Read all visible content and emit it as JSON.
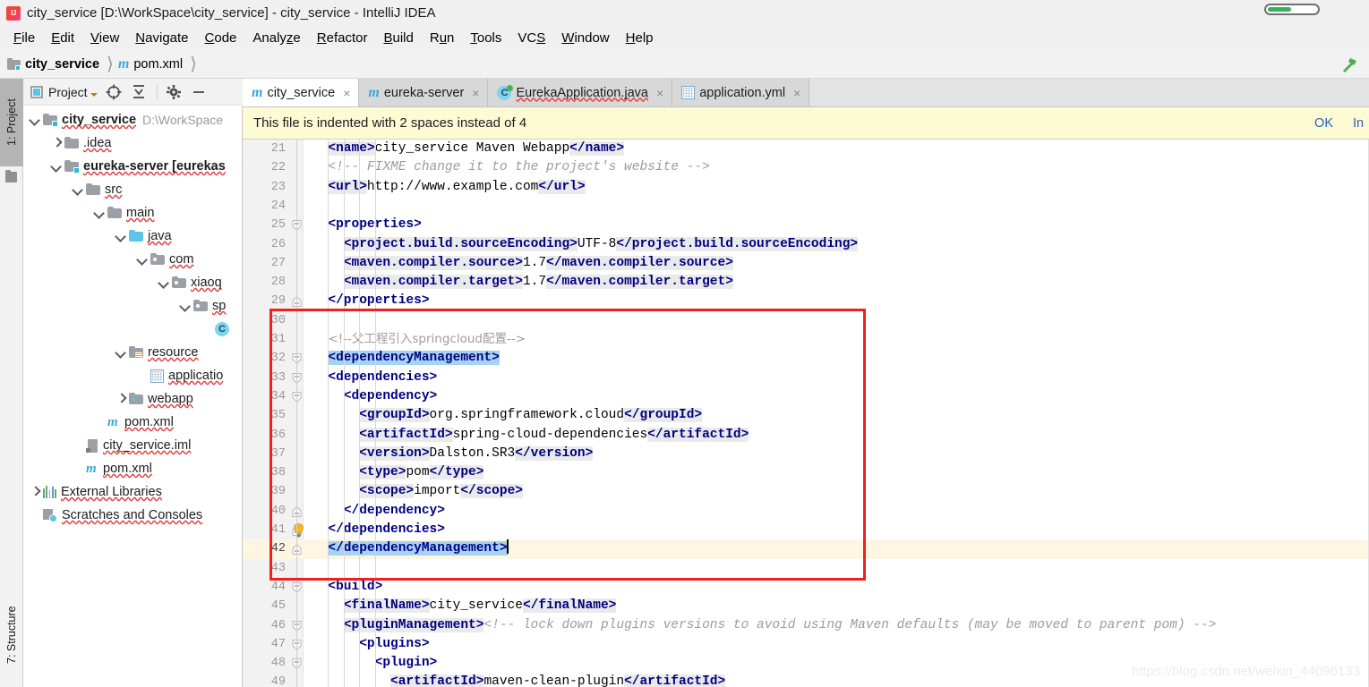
{
  "window": {
    "title": "city_service [D:\\WorkSpace\\city_service] - city_service - IntelliJ IDEA",
    "app_icon": "IJ"
  },
  "menubar": {
    "items": [
      {
        "label": "File",
        "mnemonic": "F"
      },
      {
        "label": "Edit",
        "mnemonic": "E"
      },
      {
        "label": "View",
        "mnemonic": "V"
      },
      {
        "label": "Navigate",
        "mnemonic": "N"
      },
      {
        "label": "Code",
        "mnemonic": "C"
      },
      {
        "label": "Analyze",
        "mnemonic": "z"
      },
      {
        "label": "Refactor",
        "mnemonic": "R"
      },
      {
        "label": "Build",
        "mnemonic": "B"
      },
      {
        "label": "Run",
        "mnemonic": "u"
      },
      {
        "label": "Tools",
        "mnemonic": "T"
      },
      {
        "label": "VCS",
        "mnemonic": "S"
      },
      {
        "label": "Window",
        "mnemonic": "W"
      },
      {
        "label": "Help",
        "mnemonic": "H"
      }
    ]
  },
  "navbar": {
    "crumbs": [
      {
        "label": "city_service",
        "icon": "module-icon"
      },
      {
        "label": "pom.xml",
        "icon": "maven-icon"
      }
    ],
    "build_icon": "hammer-icon"
  },
  "left_strip": {
    "project_button": "1: Project",
    "structure_button": "7: Structure"
  },
  "project_panel": {
    "title": "Project",
    "toolbar_icons": [
      "locate-icon",
      "collapse-all-icon",
      "gear-icon",
      "minimize-icon"
    ],
    "tree": [
      {
        "label": "city_service",
        "path": "D:\\WorkSpace",
        "icon": "module-icon",
        "indent": 0,
        "twisty": "down",
        "bold": true
      },
      {
        "label": ".idea",
        "icon": "folder-icon",
        "indent": 1,
        "twisty": "right",
        "bold": false
      },
      {
        "label": "eureka-server [eurekas",
        "icon": "module-icon",
        "indent": 1,
        "twisty": "down",
        "bold": true
      },
      {
        "label": "src",
        "icon": "folder-icon",
        "indent": 2,
        "twisty": "down",
        "bold": false
      },
      {
        "label": "main",
        "icon": "folder-icon",
        "indent": 3,
        "twisty": "down",
        "bold": false
      },
      {
        "label": "java",
        "icon": "source-folder-icon",
        "indent": 4,
        "twisty": "down",
        "bold": false
      },
      {
        "label": "com",
        "icon": "package-icon",
        "indent": 5,
        "twisty": "down",
        "bold": false
      },
      {
        "label": "xiaoq",
        "icon": "package-icon",
        "indent": 6,
        "twisty": "down",
        "bold": false
      },
      {
        "label": "sp",
        "icon": "package-icon",
        "indent": 7,
        "twisty": "down",
        "bold": false
      },
      {
        "label": "",
        "icon": "java-class-icon",
        "indent": 8,
        "twisty": "none",
        "bold": false
      },
      {
        "label": "resource",
        "icon": "resource-folder-icon",
        "indent": 4,
        "twisty": "down",
        "bold": false
      },
      {
        "label": "applicatio",
        "icon": "yml-file-icon",
        "indent": 5,
        "twisty": "none",
        "bold": false
      },
      {
        "label": "webapp",
        "icon": "webapp-folder-icon",
        "indent": 4,
        "twisty": "right",
        "bold": false
      },
      {
        "label": "pom.xml",
        "icon": "maven-icon",
        "indent": 3,
        "twisty": "none",
        "bold": false
      },
      {
        "label": "city_service.iml",
        "icon": "iml-file-icon",
        "indent": 2,
        "twisty": "none",
        "bold": false
      },
      {
        "label": "pom.xml",
        "icon": "maven-icon",
        "indent": 2,
        "twisty": "none",
        "bold": false
      },
      {
        "label": "External Libraries",
        "icon": "libraries-icon",
        "indent": 0,
        "twisty": "right",
        "bold": false
      },
      {
        "label": "Scratches and Consoles",
        "icon": "scratches-icon",
        "indent": 0,
        "twisty": "none",
        "bold": false
      }
    ]
  },
  "editor": {
    "tabs": [
      {
        "label": "city_service",
        "icon": "maven-icon",
        "active": true,
        "wavy": false
      },
      {
        "label": "eureka-server",
        "icon": "maven-icon",
        "active": false,
        "wavy": false
      },
      {
        "label": "EurekaApplication.java",
        "icon": "java-class-icon",
        "active": false,
        "wavy": true
      },
      {
        "label": "application.yml",
        "icon": "yml-file-icon",
        "active": false,
        "wavy": false
      }
    ],
    "close_glyph": "×",
    "notification": {
      "message": "This file is indented with 2 spaces instead of 4",
      "ok_label": "OK",
      "secondary_label": "In"
    },
    "caret_line": 42,
    "first_visible_line": 21,
    "lines": [
      {
        "n": 21,
        "indent": 0,
        "fold": "none",
        "segments": [
          {
            "t": "<name>",
            "c": "tag",
            "hl": true
          },
          {
            "t": "city_service Maven Webapp",
            "c": "plain",
            "hl": false
          },
          {
            "t": "</name>",
            "c": "tag",
            "hl": true
          }
        ]
      },
      {
        "n": 22,
        "indent": 0,
        "fold": "none",
        "segments": [
          {
            "t": "<!-- FIXME change it to the project's website -->",
            "c": "cmt",
            "hl": false
          }
        ]
      },
      {
        "n": 23,
        "indent": 0,
        "fold": "none",
        "segments": [
          {
            "t": "<url>",
            "c": "tag",
            "hl": true
          },
          {
            "t": "http://www.example.com",
            "c": "plain",
            "hl": false
          },
          {
            "t": "</url>",
            "c": "tag",
            "hl": true
          }
        ]
      },
      {
        "n": 24,
        "indent": 0,
        "fold": "none",
        "segments": []
      },
      {
        "n": 25,
        "indent": 0,
        "fold": "start",
        "segments": [
          {
            "t": "<properties>",
            "c": "tag",
            "hl": false
          }
        ]
      },
      {
        "n": 26,
        "indent": 1,
        "fold": "none",
        "segments": [
          {
            "t": "<project.build.sourceEncoding>",
            "c": "tag",
            "hl": true
          },
          {
            "t": "UTF-8",
            "c": "plain",
            "hl": false
          },
          {
            "t": "</project.build.sourceEncoding>",
            "c": "tag",
            "hl": true
          }
        ]
      },
      {
        "n": 27,
        "indent": 1,
        "fold": "none",
        "segments": [
          {
            "t": "<maven.compiler.source>",
            "c": "tag",
            "hl": true
          },
          {
            "t": "1.7",
            "c": "plain",
            "hl": false
          },
          {
            "t": "</maven.compiler.source>",
            "c": "tag",
            "hl": true
          }
        ]
      },
      {
        "n": 28,
        "indent": 1,
        "fold": "none",
        "segments": [
          {
            "t": "<maven.compiler.target>",
            "c": "tag",
            "hl": true
          },
          {
            "t": "1.7",
            "c": "plain",
            "hl": false
          },
          {
            "t": "</maven.compiler.target>",
            "c": "tag",
            "hl": true
          }
        ]
      },
      {
        "n": 29,
        "indent": 0,
        "fold": "end",
        "segments": [
          {
            "t": "</properties>",
            "c": "tag",
            "hl": false
          }
        ]
      },
      {
        "n": 30,
        "indent": 0,
        "fold": "none",
        "segments": []
      },
      {
        "n": 31,
        "indent": 0,
        "fold": "none",
        "segments": [
          {
            "t": "<!--父工程引入springcloud配置-->",
            "c": "cmt",
            "hl": false
          }
        ]
      },
      {
        "n": 32,
        "indent": 0,
        "fold": "start",
        "segments": [
          {
            "t": "<dependencyManagement>",
            "c": "tag",
            "hl": false,
            "sel": true
          }
        ]
      },
      {
        "n": 33,
        "indent": 0,
        "fold": "start",
        "segments": [
          {
            "t": "<dependencies>",
            "c": "tag",
            "hl": false
          }
        ]
      },
      {
        "n": 34,
        "indent": 1,
        "fold": "start",
        "segments": [
          {
            "t": "<dependency>",
            "c": "tag",
            "hl": false
          }
        ]
      },
      {
        "n": 35,
        "indent": 2,
        "fold": "none",
        "segments": [
          {
            "t": "<groupId>",
            "c": "tag",
            "hl": true
          },
          {
            "t": "org.springframework.cloud",
            "c": "plain",
            "hl": false
          },
          {
            "t": "</groupId>",
            "c": "tag",
            "hl": true
          }
        ]
      },
      {
        "n": 36,
        "indent": 2,
        "fold": "none",
        "segments": [
          {
            "t": "<artifactId>",
            "c": "tag",
            "hl": true
          },
          {
            "t": "spring-cloud-dependencies",
            "c": "plain",
            "hl": false
          },
          {
            "t": "</artifactId>",
            "c": "tag",
            "hl": true
          }
        ]
      },
      {
        "n": 37,
        "indent": 2,
        "fold": "none",
        "segments": [
          {
            "t": "<version>",
            "c": "tag",
            "hl": true
          },
          {
            "t": "Dalston.SR3",
            "c": "plain",
            "hl": false
          },
          {
            "t": "</version>",
            "c": "tag",
            "hl": true
          }
        ]
      },
      {
        "n": 38,
        "indent": 2,
        "fold": "none",
        "segments": [
          {
            "t": "<type>",
            "c": "tag",
            "hl": true
          },
          {
            "t": "pom",
            "c": "plain",
            "hl": false
          },
          {
            "t": "</type>",
            "c": "tag",
            "hl": true
          }
        ]
      },
      {
        "n": 39,
        "indent": 2,
        "fold": "none",
        "segments": [
          {
            "t": "<scope>",
            "c": "tag",
            "hl": true
          },
          {
            "t": "import",
            "c": "plain",
            "hl": false
          },
          {
            "t": "</scope>",
            "c": "tag",
            "hl": true
          }
        ]
      },
      {
        "n": 40,
        "indent": 1,
        "fold": "end",
        "segments": [
          {
            "t": "</dependency>",
            "c": "tag",
            "hl": false
          }
        ]
      },
      {
        "n": 41,
        "indent": 0,
        "fold": "end",
        "bulb": true,
        "segments": [
          {
            "t": "</dependencies>",
            "c": "tag",
            "hl": false
          }
        ]
      },
      {
        "n": 42,
        "indent": 0,
        "fold": "end",
        "current": true,
        "caret": true,
        "segments": [
          {
            "t": "</dependencyManagement>",
            "c": "tag",
            "hl": false,
            "sel": true
          }
        ]
      },
      {
        "n": 43,
        "indent": 0,
        "fold": "none",
        "segments": []
      },
      {
        "n": 44,
        "indent": 0,
        "fold": "start",
        "segments": [
          {
            "t": "<build>",
            "c": "tag",
            "hl": false
          }
        ]
      },
      {
        "n": 45,
        "indent": 1,
        "fold": "none",
        "segments": [
          {
            "t": "<finalName>",
            "c": "tag",
            "hl": true
          },
          {
            "t": "city_service",
            "c": "plain",
            "hl": false
          },
          {
            "t": "</finalName>",
            "c": "tag",
            "hl": true
          }
        ]
      },
      {
        "n": 46,
        "indent": 1,
        "fold": "start",
        "segments": [
          {
            "t": "<pluginManagement>",
            "c": "tag",
            "hl": true
          },
          {
            "t": "<!-- lock down plugins versions to avoid using Maven defaults (may be moved to parent pom) -->",
            "c": "cmt",
            "hl": false
          }
        ]
      },
      {
        "n": 47,
        "indent": 2,
        "fold": "start",
        "segments": [
          {
            "t": "<plugins>",
            "c": "tag",
            "hl": false
          }
        ]
      },
      {
        "n": 48,
        "indent": 3,
        "fold": "start",
        "segments": [
          {
            "t": "<plugin>",
            "c": "tag",
            "hl": false
          }
        ]
      },
      {
        "n": 49,
        "indent": 4,
        "fold": "none",
        "segments": [
          {
            "t": "<artifactId>",
            "c": "tag",
            "hl": true
          },
          {
            "t": "maven-clean-plugin",
            "c": "plain",
            "hl": false
          },
          {
            "t": "</artifactId>",
            "c": "tag",
            "hl": true
          }
        ]
      }
    ]
  },
  "annotation": {
    "redbox_color": "#f02020"
  },
  "watermark": "https://blog.csdn.net/weixin_44096133"
}
